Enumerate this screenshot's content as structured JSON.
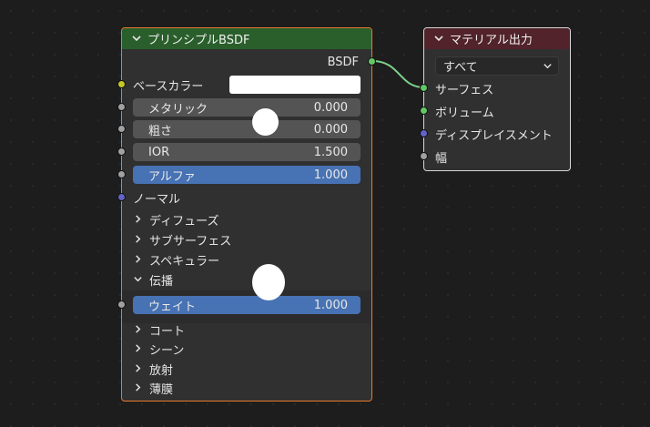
{
  "bsdf_node": {
    "title": "プリンシプルBSDF",
    "output_label": "BSDF",
    "base_color_label": "ベースカラー",
    "base_color_value": "#ffffff",
    "fields": [
      {
        "label": "メタリック",
        "value": "0.000"
      },
      {
        "label": "粗さ",
        "value": "0.000"
      },
      {
        "label": "IOR",
        "value": "1.500"
      },
      {
        "label": "アルファ",
        "value": "1.000"
      }
    ],
    "normal_label": "ノーマル",
    "panels": [
      {
        "label": "ディフューズ",
        "expanded": false
      },
      {
        "label": "サブサーフェス",
        "expanded": false
      },
      {
        "label": "スペキュラー",
        "expanded": false
      },
      {
        "label": "伝播",
        "expanded": true
      }
    ],
    "weight": {
      "label": "ウェイト",
      "value": "1.000"
    },
    "panels_after": [
      {
        "label": "コート"
      },
      {
        "label": "シーン"
      },
      {
        "label": "放射"
      },
      {
        "label": "薄膜"
      }
    ]
  },
  "output_node": {
    "title": "マテリアル出力",
    "target_dropdown": "すべて",
    "inputs": [
      {
        "label": "サーフェス"
      },
      {
        "label": "ボリューム"
      },
      {
        "label": "ディスプレイスメント"
      },
      {
        "label": "幅"
      }
    ]
  },
  "colors": {
    "bsdf_border": "#e67a2e",
    "bsdf_header": "#2a5f2c",
    "output_header": "#52232b",
    "socket_shader": "#63c763",
    "socket_color": "#c7c729",
    "socket_float": "#a1a1a1",
    "socket_vector": "#6363c7",
    "field_active": "#4772b3",
    "link": "#7cd08a"
  },
  "icons": [
    "chevron-down-icon",
    "chevron-right-icon",
    "dropdown-chevron-icon"
  ]
}
